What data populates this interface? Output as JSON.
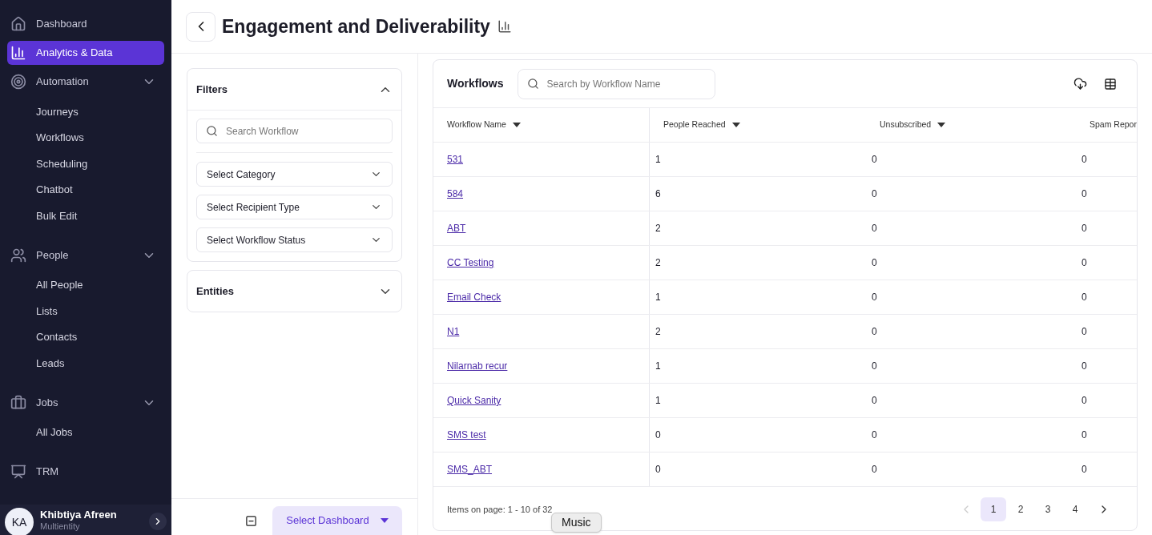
{
  "sidebar": {
    "items": [
      {
        "label": "Dashboard",
        "selected": false
      },
      {
        "label": "Analytics & Data",
        "selected": true
      },
      {
        "label": "Automation",
        "selected": false,
        "expanded": true,
        "children": [
          {
            "label": "Journeys",
            "selected": false
          },
          {
            "label": "Workflows",
            "selected": false
          },
          {
            "label": "Scheduling",
            "selected": false
          },
          {
            "label": "Chatbot",
            "selected": false
          },
          {
            "label": "Bulk Edit",
            "selected": false
          }
        ]
      },
      {
        "label": "People",
        "selected": false,
        "expanded": true,
        "children": [
          {
            "label": "All People",
            "selected": false
          },
          {
            "label": "Lists",
            "selected": false
          },
          {
            "label": "Contacts",
            "selected": false
          },
          {
            "label": "Leads",
            "selected": false
          }
        ]
      },
      {
        "label": "Jobs",
        "selected": false,
        "expanded": true,
        "children": [
          {
            "label": "All Jobs",
            "selected": false
          }
        ]
      },
      {
        "label": "TRM",
        "selected": false
      }
    ],
    "user": {
      "initials": "KA",
      "name": "Khibtiya Afreen",
      "subtitle": "Multientity"
    }
  },
  "header": {
    "title": "Engagement and Deliverability"
  },
  "filters": {
    "title": "Filters",
    "expanded": true,
    "search_placeholder": "Search Workflow",
    "selects": [
      "Select Category",
      "Select Recipient Type",
      "Select Workflow Status"
    ]
  },
  "entities": {
    "title": "Entities",
    "expanded": false
  },
  "dashboard_button": "Select Dashboard",
  "table": {
    "title": "Workflows",
    "search_placeholder": "Search by Workflow Name",
    "columns": [
      "Workflow Name",
      "People Reached",
      "Unsubscribed",
      "Spam Repor"
    ],
    "rows": [
      [
        "531",
        "1",
        "0",
        "0"
      ],
      [
        "584",
        "6",
        "0",
        "0"
      ],
      [
        "ABT",
        "2",
        "0",
        "0"
      ],
      [
        "CC Testing",
        "2",
        "0",
        "0"
      ],
      [
        "Email Check",
        "1",
        "0",
        "0"
      ],
      [
        "N1",
        "2",
        "0",
        "0"
      ],
      [
        "Nilarnab recur",
        "1",
        "0",
        "0"
      ],
      [
        "Quick Sanity",
        "1",
        "0",
        "0"
      ],
      [
        "SMS test",
        "0",
        "0",
        "0"
      ],
      [
        "SMS_ABT",
        "0",
        "0",
        "0"
      ]
    ],
    "items_text": "Items on page: 1 - 10 of 32",
    "pages": [
      {
        "label": "1",
        "selected": true
      },
      {
        "label": "2",
        "selected": false
      },
      {
        "label": "3",
        "selected": false
      },
      {
        "label": "4",
        "selected": false
      }
    ],
    "prev_disabled": true
  },
  "tooltip": {
    "text": "Music"
  }
}
